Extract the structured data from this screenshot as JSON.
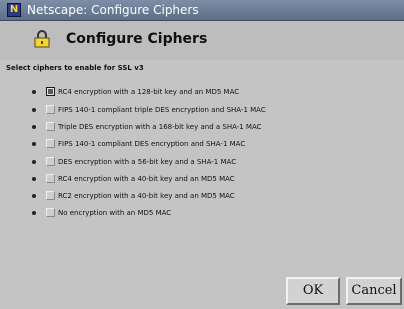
{
  "window": {
    "title": "Netscape: Configure Ciphers"
  },
  "header": {
    "title": "Configure Ciphers",
    "icon": "lock-icon"
  },
  "section_label": "Select ciphers to enable for SSL v3",
  "ciphers": [
    {
      "label": "RC4 encryption with a 128-bit key and an MD5 MAC",
      "checked": true
    },
    {
      "label": "FIPS 140-1 compliant triple DES encryption and SHA-1 MAC",
      "checked": false
    },
    {
      "label": "Triple DES encryption with a 168-bit key and a SHA-1 MAC",
      "checked": false
    },
    {
      "label": "FIPS 140-1 compliant DES encryption and SHA-1 MAC",
      "checked": false
    },
    {
      "label": "DES encryption with a 56-bit key and a SHA-1 MAC",
      "checked": false
    },
    {
      "label": "RC4 encryption with a 40-bit key and an MD5 MAC",
      "checked": false
    },
    {
      "label": "RC2 encryption with a 40-bit key and an MD5 MAC",
      "checked": false
    },
    {
      "label": "No encryption with an MD5 MAC",
      "checked": false
    }
  ],
  "buttons": {
    "ok": "OK",
    "cancel": "Cancel"
  }
}
